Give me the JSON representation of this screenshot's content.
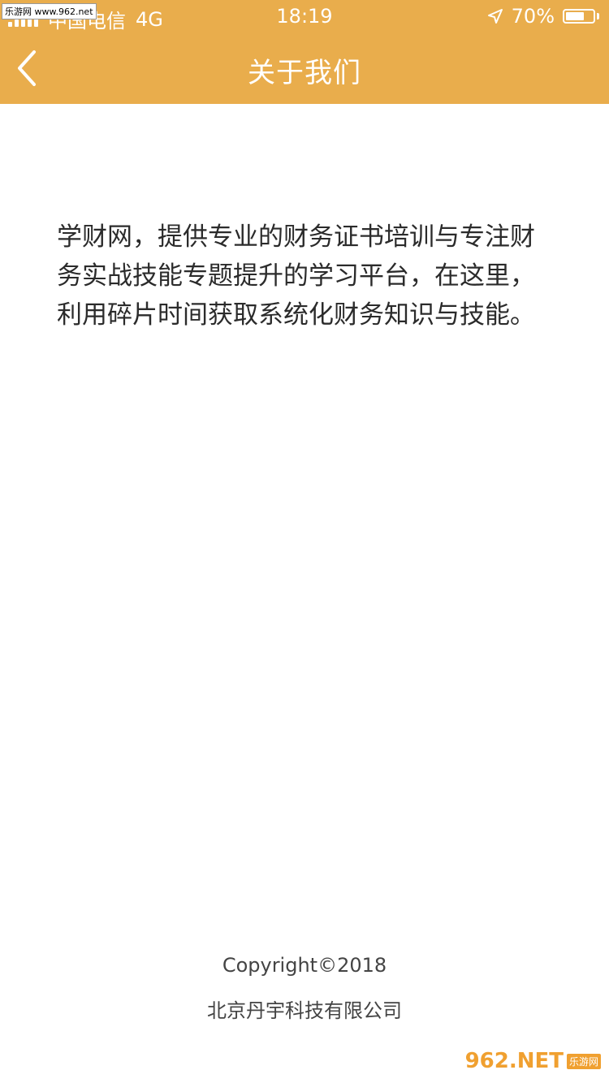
{
  "status_bar": {
    "carrier": "中国电信",
    "network": "4G",
    "time": "18:19",
    "battery_percent": "70%",
    "battery_level": 0.7
  },
  "watermark_top": "乐游网 www.962.net",
  "nav": {
    "title": "关于我们"
  },
  "content": {
    "intro": "学财网，提供专业的财务证书培训与专注财务实战技能专题提升的学习平台，在这里，利用碎片时间获取系统化财务知识与技能。"
  },
  "footer": {
    "copyright": "Copyright©2018",
    "company": "北京丹宇科技有限公司"
  },
  "watermark_bottom": {
    "main": "962.NET",
    "sub": "乐游网"
  },
  "colors": {
    "header_bg": "#E9AD4C",
    "text": "#2b2b2b"
  }
}
